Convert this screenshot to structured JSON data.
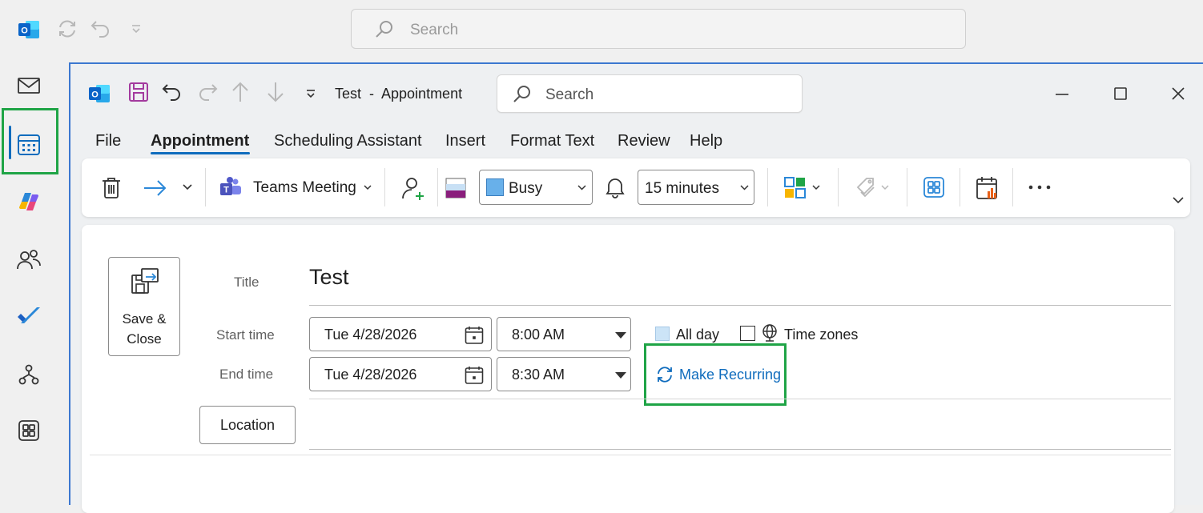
{
  "app": {
    "search_placeholder": "Search"
  },
  "left_rail": {
    "items": [
      {
        "name": "mail-icon"
      },
      {
        "name": "calendar-icon",
        "active": true
      },
      {
        "name": "copilot-icon"
      },
      {
        "name": "people-icon"
      },
      {
        "name": "todo-icon"
      },
      {
        "name": "org-explorer-icon"
      },
      {
        "name": "apps-icon"
      }
    ]
  },
  "appointment": {
    "window_title": "Test  -  Appointment",
    "search_placeholder": "Search",
    "menu_tabs": [
      "File",
      "Appointment",
      "Scheduling Assistant",
      "Insert",
      "Format Text",
      "Review",
      "Help"
    ],
    "active_tab": "Appointment",
    "ribbon": {
      "teams_label": "Teams Meeting",
      "show_as": "Busy",
      "reminder": "15 minutes"
    },
    "form": {
      "save_close_label": "Save & Close",
      "title_label": "Title",
      "title_value": "Test",
      "start_label": "Start time",
      "start_date": "Tue 4/28/2026",
      "start_time": "8:00 AM",
      "end_label": "End time",
      "end_date": "Tue 4/28/2026",
      "end_time": "8:30 AM",
      "all_day_label": "All day",
      "time_zones_label": "Time zones",
      "make_recurring_label": "Make Recurring",
      "location_label": "Location"
    }
  },
  "colors": {
    "accent": "#0f6cbd",
    "highlight": "#1fa446",
    "outlook_blue": "#0a64c8",
    "save_purple": "#a33a9e"
  }
}
